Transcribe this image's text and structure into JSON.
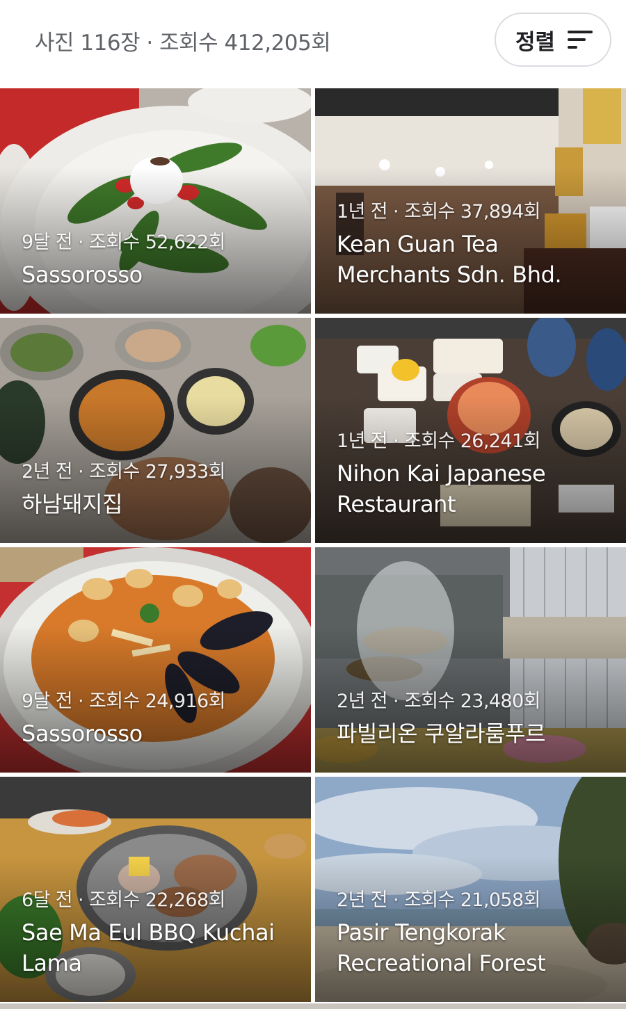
{
  "header": {
    "summary": "사진 116장 · 조회수 412,205회",
    "sort_label": "정렬"
  },
  "photos": [
    {
      "meta": "9달 전 · 조회수 52,622회",
      "name": "Sassorosso",
      "kind": "burrata-salad"
    },
    {
      "meta": "1년 전 · 조회수 37,894회",
      "name": "Kean Guan Tea Merchants Sdn. Bhd.",
      "kind": "tea-shop-interior"
    },
    {
      "meta": "2년 전 · 조회수 27,933회",
      "name": "하남돼지집",
      "kind": "korean-side-dishes"
    },
    {
      "meta": "1년 전 · 조회수 26,241회",
      "name": "Nihon Kai Japanese Restaurant",
      "kind": "japanese-set-meal"
    },
    {
      "meta": "9달 전 · 조회수 24,916회",
      "name": "Sassorosso",
      "kind": "seafood-pasta"
    },
    {
      "meta": "2년 전 · 조회수 23,480회",
      "name": "파빌리온 쿠알라룸푸르",
      "kind": "mall-fountain"
    },
    {
      "meta": "6달 전 · 조회수 22,268회",
      "name": "Sae Ma Eul BBQ Kuchai Lama",
      "kind": "korean-bbq-grill"
    },
    {
      "meta": "2년 전 · 조회수 21,058회",
      "name": "Pasir Tengkorak Recreational Forest",
      "kind": "beach-landscape"
    }
  ],
  "icons": {
    "sort": "sort-lines-icon"
  },
  "colors": {
    "summary_text": "#5f6368",
    "sort_border": "#dadce0"
  }
}
